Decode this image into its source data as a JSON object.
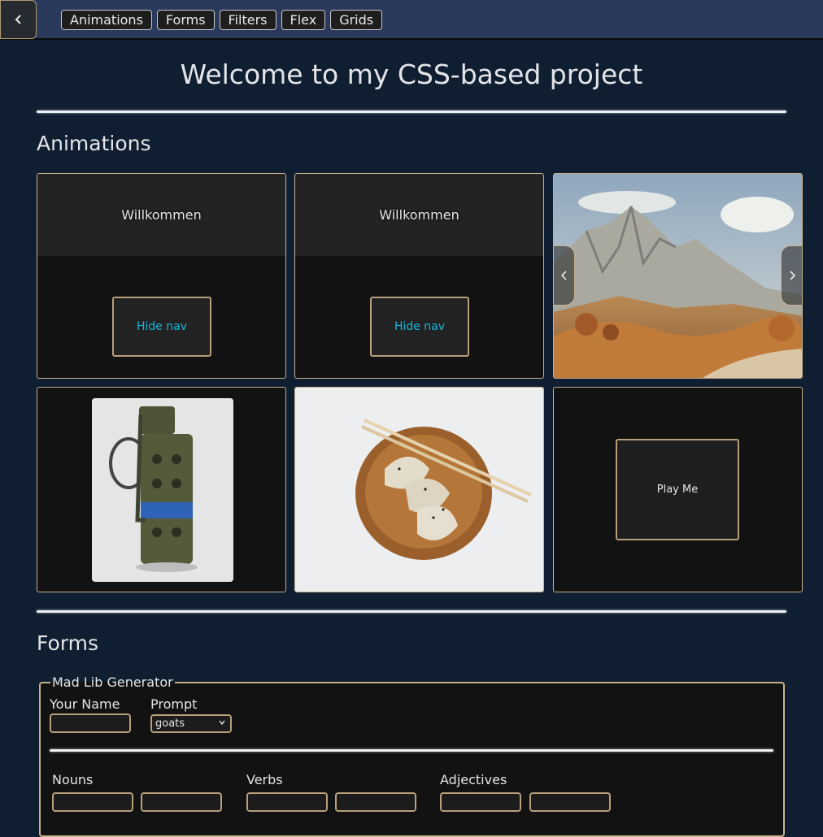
{
  "nav": {
    "back_icon": "chevron-left-icon",
    "items": [
      {
        "label": "Animations"
      },
      {
        "label": "Forms"
      },
      {
        "label": "Filters"
      },
      {
        "label": "Flex"
      },
      {
        "label": "Grids"
      }
    ]
  },
  "page": {
    "title": "Welcome to my CSS-based project"
  },
  "animations": {
    "heading": "Animations",
    "card1": {
      "header": "Willkommen",
      "button": "Hide nav"
    },
    "card2": {
      "header": "Willkommen",
      "button": "Hide nav"
    },
    "carousel": {
      "prev_icon": "chevron-left-icon",
      "next_icon": "chevron-right-icon"
    },
    "card6": {
      "button": "Play Me"
    }
  },
  "forms": {
    "heading": "Forms",
    "legend": "Mad Lib Generator",
    "your_name_label": "Your Name",
    "prompt_label": "Prompt",
    "prompt_value": "goats",
    "nouns_label": "Nouns",
    "verbs_label": "Verbs",
    "adjectives_label": "Adjectives"
  },
  "colors": {
    "background": "#0f1e31",
    "topbar": "#2a3a5c",
    "border_accent": "#c7b18d",
    "button_text_accent": "#18b5d9"
  }
}
